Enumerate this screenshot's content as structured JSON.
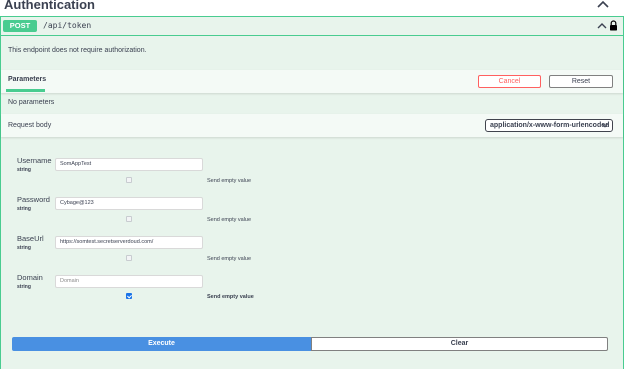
{
  "section": {
    "title": "Authentication",
    "chevron_icon": "chevron-up-icon"
  },
  "operation": {
    "method": "POST",
    "path": "/api/token",
    "method_color": "#49cc90",
    "auth_note": "This endpoint does not require authorization.",
    "chevron_icon": "chevron-up-icon",
    "lock_icon": "lock-icon"
  },
  "parameters": {
    "tab_label": "Parameters",
    "cancel_label": "Cancel",
    "reset_label": "Reset",
    "empty_text": "No parameters"
  },
  "request_body": {
    "label": "Request body",
    "content_type": "application/x-www-form-urlencoded"
  },
  "fields": [
    {
      "name": "Username",
      "type": "string",
      "value": "SomAppTest",
      "placeholder": "",
      "send_empty": false,
      "send_empty_label": "Send empty value"
    },
    {
      "name": "Password",
      "type": "string",
      "value": "Cybage@123",
      "placeholder": "",
      "send_empty": false,
      "send_empty_label": "Send empty value"
    },
    {
      "name": "BaseUrl",
      "type": "string",
      "value": "https://somtest.secretserverdoud.com/",
      "placeholder": "",
      "send_empty": false,
      "send_empty_label": "Send empty value"
    },
    {
      "name": "Domain",
      "type": "string",
      "value": "",
      "placeholder": "Domain",
      "send_empty": true,
      "send_empty_label": "Send empty value"
    }
  ],
  "actions": {
    "execute_label": "Execute",
    "clear_label": "Clear",
    "execute_color": "#4990e2"
  }
}
